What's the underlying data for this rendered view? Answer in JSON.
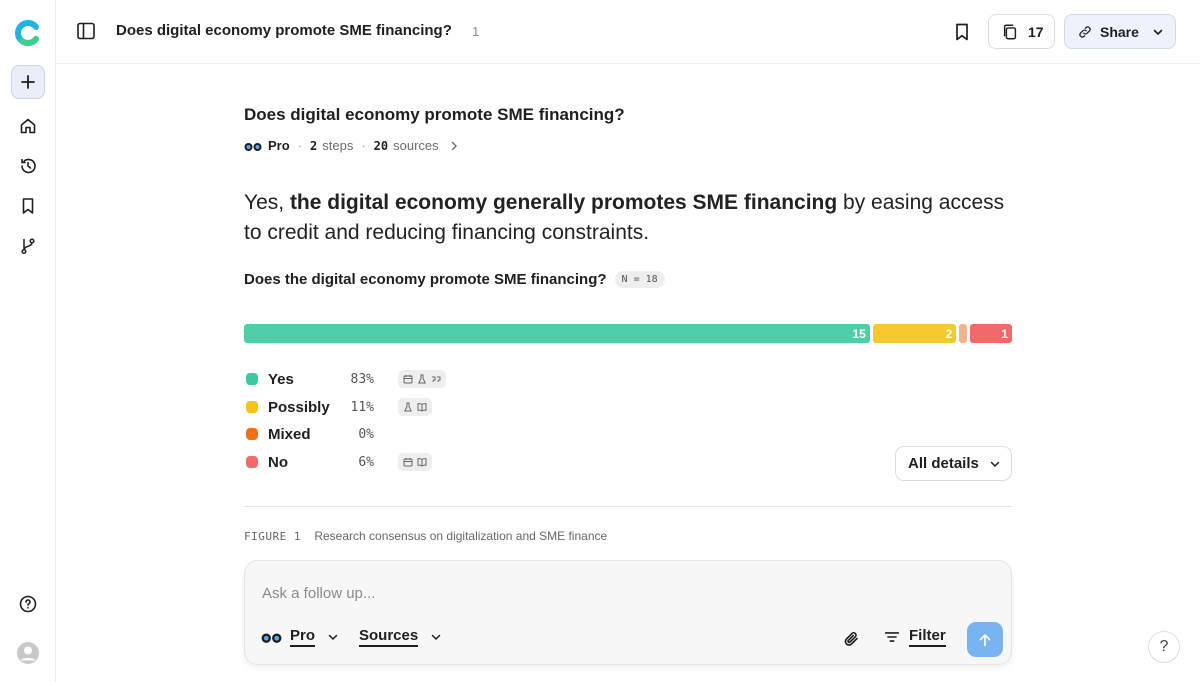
{
  "header": {
    "title": "Does digital economy promote SME financing?",
    "title_count": "1",
    "pages_count": "17",
    "share_label": "Share"
  },
  "question": {
    "title": "Does digital economy promote SME financing?",
    "mode": "Pro",
    "steps_count": "2",
    "steps_label": "steps",
    "sources_count": "20",
    "sources_label": "sources"
  },
  "answer": {
    "lead": "Yes, ",
    "bold": "the digital economy generally promotes SME financing",
    "rest": " by easing access to credit and reducing financing constraints."
  },
  "meter": {
    "title": "Does the digital economy promote SME financing?",
    "n_label": "N = 18"
  },
  "chart_data": {
    "type": "bar",
    "title": "Does the digital economy promote SME financing?",
    "categories": [
      "Yes",
      "Possibly",
      "Mixed",
      "No"
    ],
    "values": [
      15,
      2,
      0,
      1
    ],
    "percent_labels": [
      "83%",
      "11%",
      "0%",
      "6%"
    ],
    "bar_labels": [
      "15",
      "2",
      "",
      "1"
    ],
    "colors": [
      "#4ecfa9",
      "#f8c92e",
      "#f8b28a",
      "#f06a6a"
    ],
    "legend_colors": [
      "#3bc9a2",
      "#f8c31a",
      "#f07018",
      "#f26b6b"
    ]
  },
  "legend": {
    "icons": [
      [
        "calendar-icon",
        "flask-icon",
        "quote-icon"
      ],
      [
        "flask-icon",
        "book-icon"
      ],
      [],
      [
        "calendar-icon",
        "book-icon"
      ]
    ]
  },
  "details_label": "All details",
  "figure": {
    "label": "FIGURE 1",
    "caption": "Research consensus on digitalization and SME finance"
  },
  "followup": {
    "placeholder": "Ask a follow up...",
    "mode_label": "Pro",
    "sources_label": "Sources",
    "filter_label": "Filter"
  },
  "help_label": "?"
}
